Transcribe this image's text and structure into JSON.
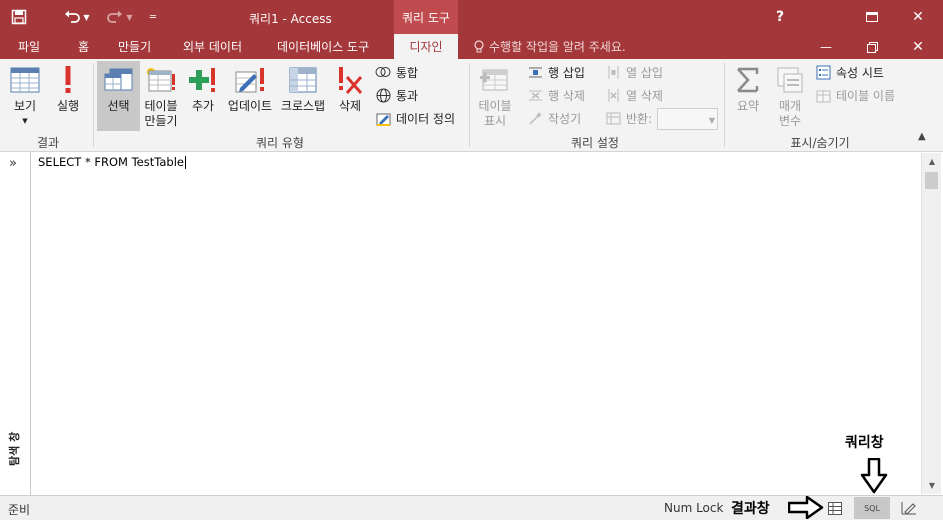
{
  "titlebar": {
    "document_title": "쿼리1 - Access",
    "tools_header": "쿼리 도구",
    "help": "?",
    "minimize": "—",
    "restore": "□",
    "close": "✕"
  },
  "tabs": {
    "file": "파일",
    "home": "홈",
    "create": "만들기",
    "external": "외부 데이터",
    "dbtools": "데이터베이스 도구",
    "design": "디자인",
    "tellme": "수행할 작업을 알려 주세요."
  },
  "ribbon": {
    "results": {
      "label": "결과",
      "view": "보기",
      "run": "실행"
    },
    "querytype": {
      "label": "쿼리 유형",
      "select": "선택",
      "maketable_1": "테이블",
      "maketable_2": "만들기",
      "append": "추가",
      "update": "업데이트",
      "crosstab": "크로스탭",
      "delete": "삭제",
      "union": "통합",
      "passthrough": "통과",
      "datadef": "데이터 정의"
    },
    "setup": {
      "label": "쿼리 설정",
      "showtable_1": "테이블",
      "showtable_2": "표시",
      "insert_rows": "행 삽입",
      "delete_rows": "행 삭제",
      "builder": "작성기",
      "insert_cols": "열 삽입",
      "delete_cols": "열 삭제",
      "return": "반환:"
    },
    "showhide": {
      "label": "표시/숨기기",
      "totals": "요약",
      "params_1": "매개",
      "params_2": "변수",
      "property_sheet": "속성 시트",
      "table_names": "테이블 이름"
    }
  },
  "navpane": {
    "expand": "»",
    "label": "탐색 창"
  },
  "editor": {
    "sql": "SELECT * FROM TestTable"
  },
  "statusbar": {
    "ready": "준비",
    "numlock": "Num Lock",
    "sql_view": "SQL"
  },
  "annotations": {
    "query_window": "쿼리창",
    "result_window": "결과창"
  },
  "colors": {
    "accent": "#a4373a",
    "ribbon_bg": "#f3f3f3"
  }
}
